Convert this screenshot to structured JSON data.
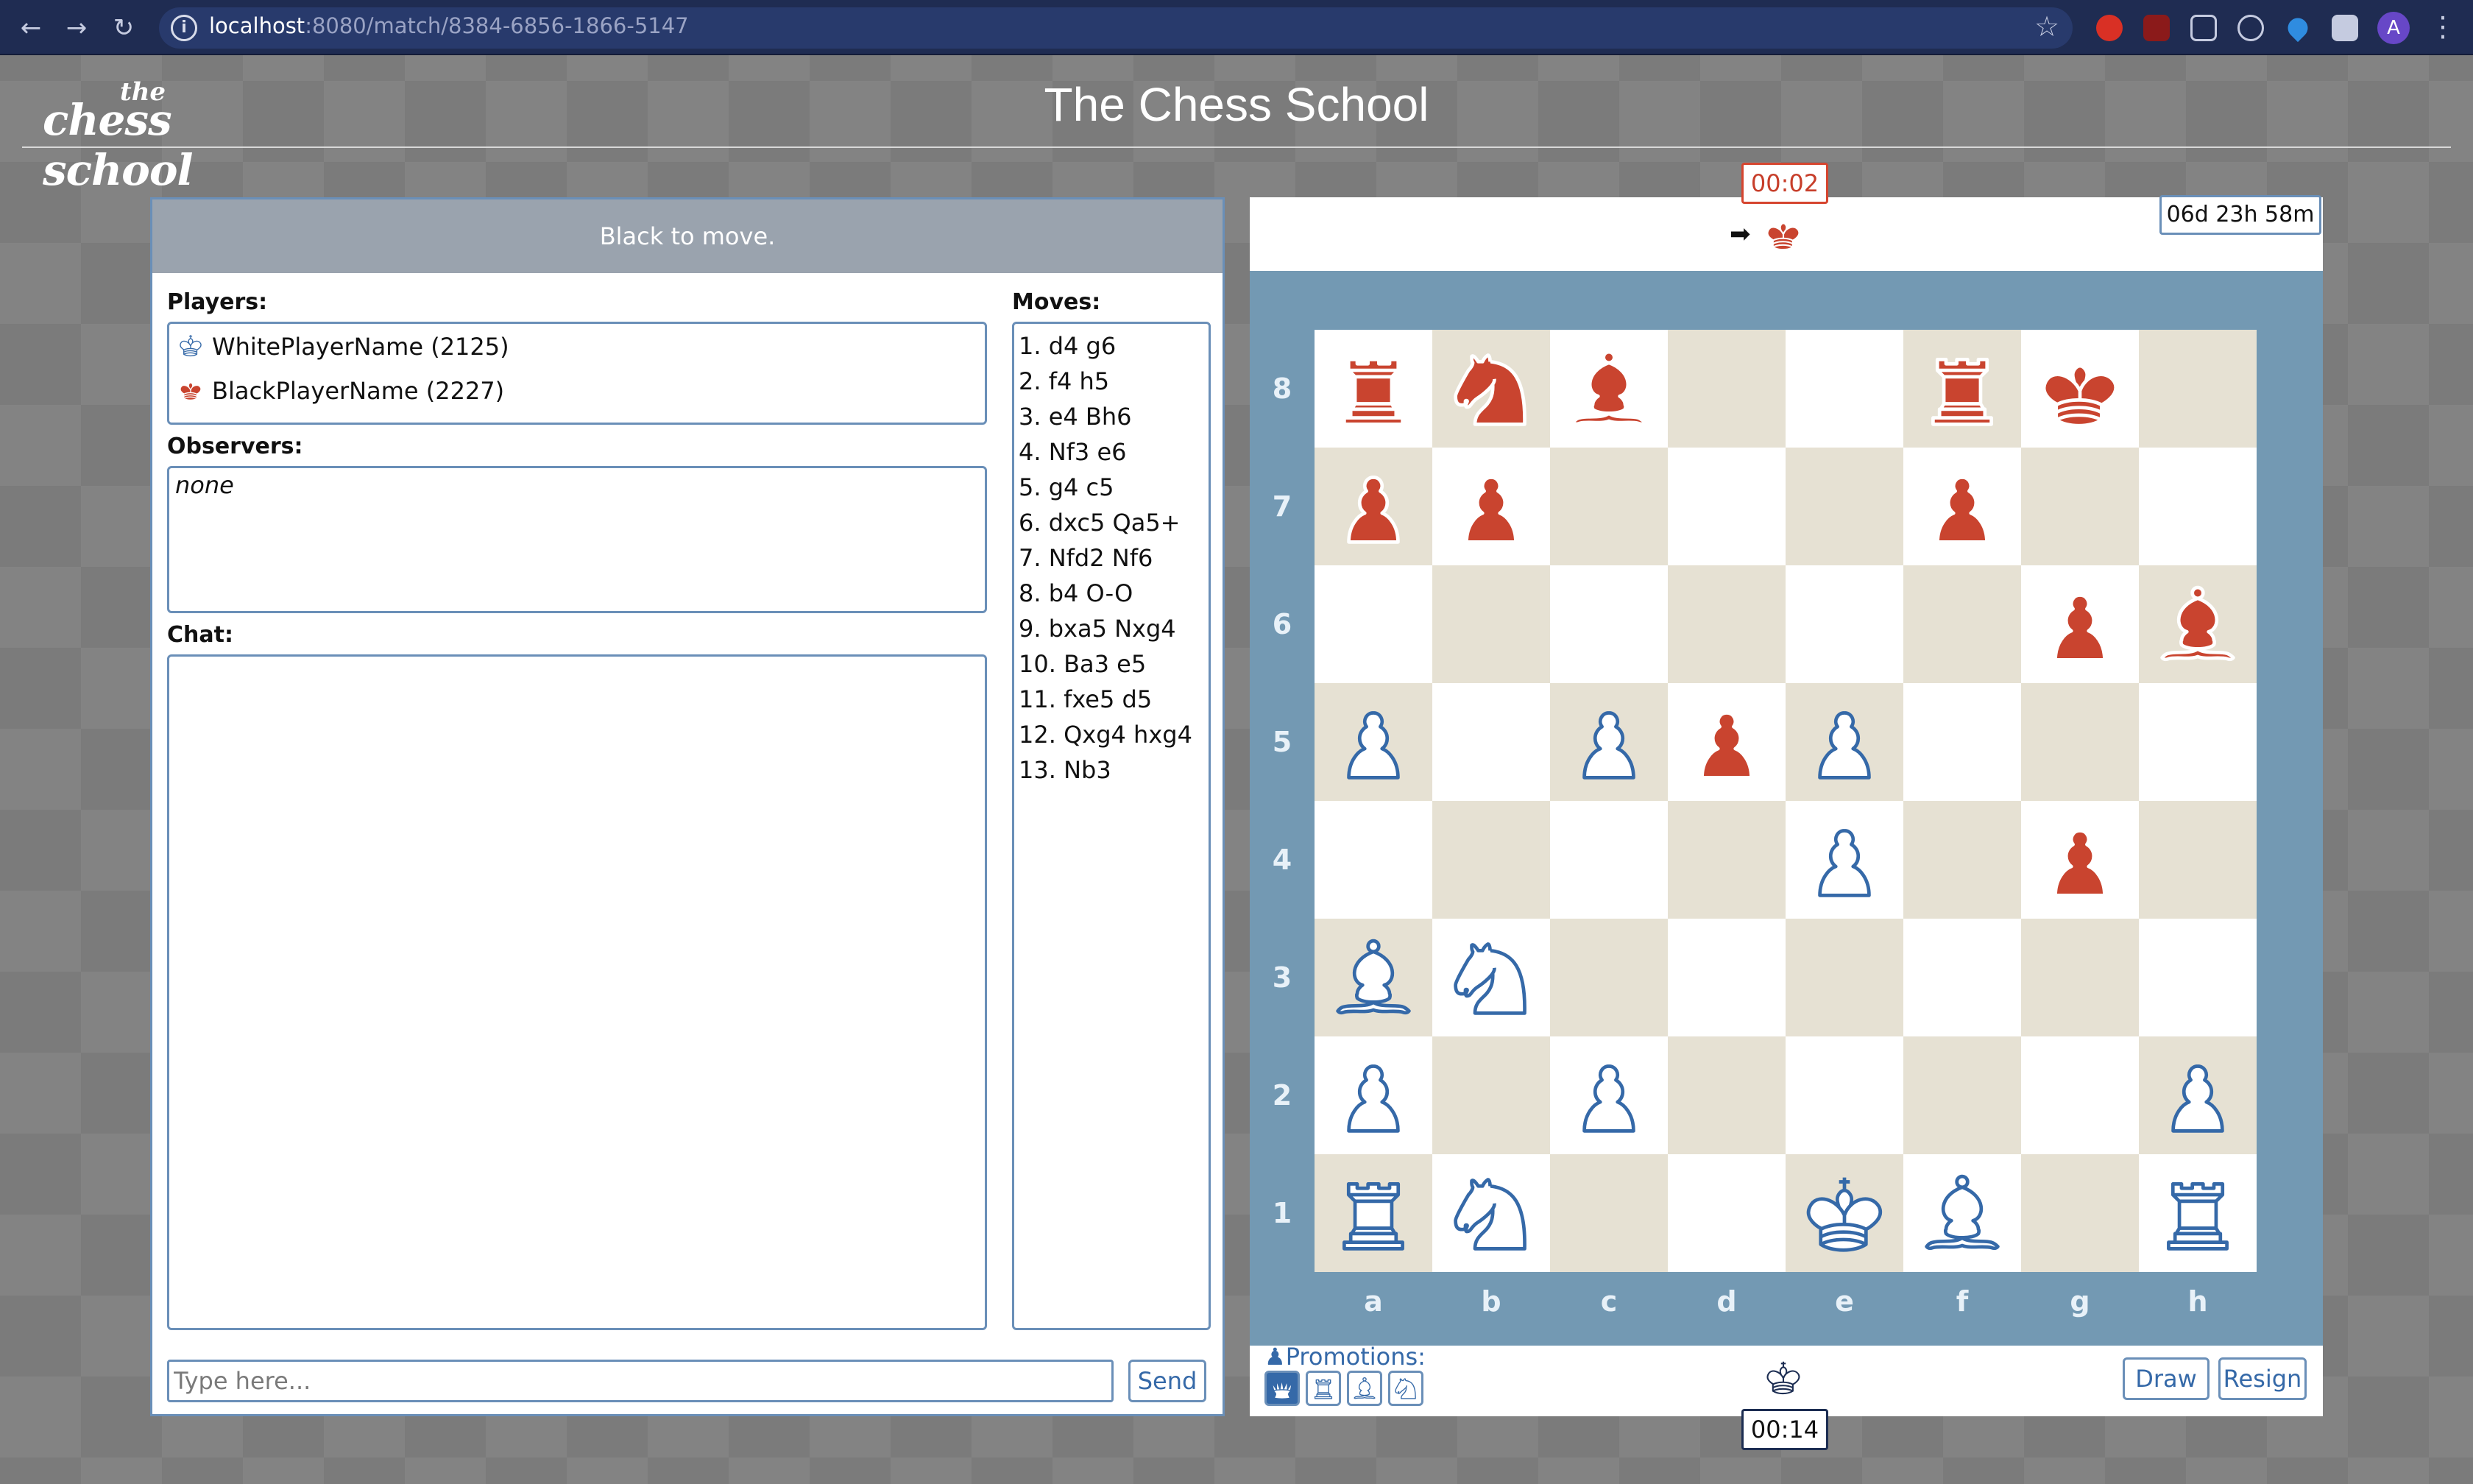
{
  "browser": {
    "url_host": "localhost",
    "url_path": ":8080/match/8384-6856-1866-5147",
    "extension_icons": [
      "shield-icon",
      "ublock-icon",
      "screen-icon",
      "react-icon",
      "drop-icon",
      "puzzle-icon"
    ],
    "profile_initial": "A"
  },
  "header": {
    "logo_small": "the",
    "logo_main": "chess school",
    "title": "The Chess School"
  },
  "left_panel": {
    "status": "Black to move.",
    "players_label": "Players:",
    "players": [
      {
        "name": "WhitePlayerName (2125)",
        "color": "white"
      },
      {
        "name": "BlackPlayerName (2227)",
        "color": "black"
      }
    ],
    "observers_label": "Observers:",
    "observers_value": "none",
    "chat_label": "Chat:",
    "chat_placeholder": "Type here...",
    "send_label": "Send",
    "moves_label": "Moves:",
    "moves": [
      "1. d4 g6",
      "2. f4 h5",
      "3. e4 Bh6",
      "4. Nf3 e6",
      "5. g4 c5",
      "6. dxc5 Qa5+",
      "7. Nfd2 Nf6",
      "8. b4 O-O",
      "9. bxa5 Nxg4",
      "10. Ba3 e5",
      "11. fxe5 d5",
      "12. Qxg4 hxg4",
      "13. Nb3"
    ]
  },
  "board_panel": {
    "black_clock": "00:02",
    "white_clock": "00:14",
    "game_time": "06d 23h 58m",
    "turn_arrow": "➡",
    "files": [
      "a",
      "b",
      "c",
      "d",
      "e",
      "f",
      "g",
      "h"
    ],
    "ranks": [
      "8",
      "7",
      "6",
      "5",
      "4",
      "3",
      "2",
      "1"
    ],
    "position": [
      [
        "bR",
        "bN",
        "bB",
        "",
        "",
        "bR",
        "bK",
        ""
      ],
      [
        "bP",
        "bP",
        "",
        "",
        "",
        "bP",
        "",
        ""
      ],
      [
        "",
        "",
        "",
        "",
        "",
        "",
        "bP",
        "bB"
      ],
      [
        "wP",
        "",
        "wP",
        "bP",
        "wP",
        "",
        "",
        ""
      ],
      [
        "",
        "",
        "",
        "",
        "wP",
        "",
        "bP",
        ""
      ],
      [
        "wB",
        "wN",
        "",
        "",
        "",
        "",
        "",
        ""
      ],
      [
        "wP",
        "",
        "wP",
        "",
        "",
        "",
        "",
        "wP"
      ],
      [
        "wR",
        "wN",
        "",
        "",
        "wK",
        "wB",
        "",
        "wR"
      ]
    ],
    "promotions_label": "Promotions:",
    "promotion_pieces": [
      "queen",
      "rook",
      "bishop",
      "knight"
    ],
    "promotion_selected": "queen",
    "draw_label": "Draw",
    "resign_label": "Resign"
  },
  "colors": {
    "black_piece": "#c9442f",
    "white_piece": "#3569a8",
    "board_frame": "#7399b3",
    "dark_square": "#e6e1d3",
    "light_square": "#ffffff",
    "browser_bar": "#1f2c52"
  }
}
